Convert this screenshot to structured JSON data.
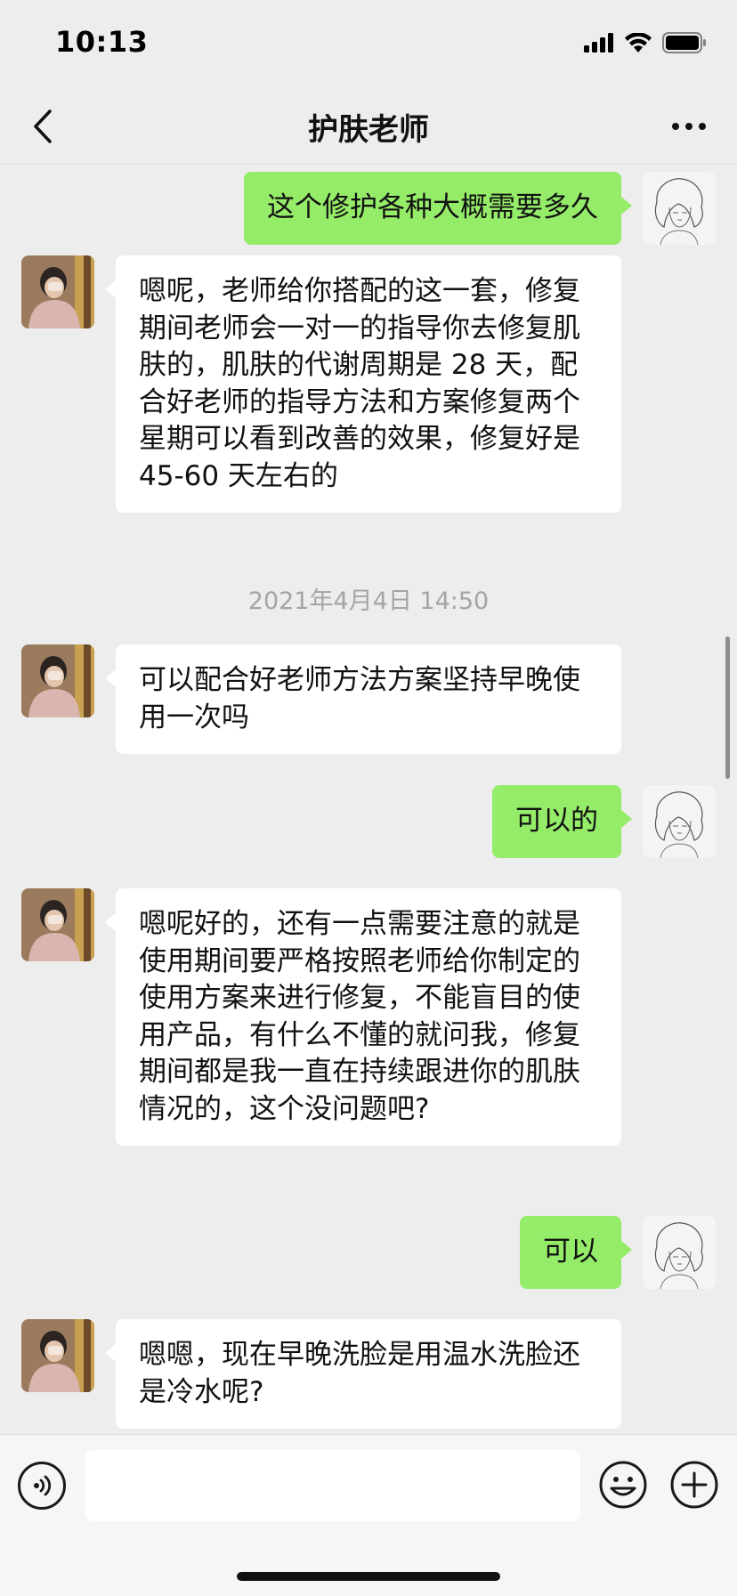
{
  "status_bar": {
    "time": "10:13"
  },
  "header": {
    "title": "护肤老师"
  },
  "messages": [
    {
      "side": "out",
      "text": "这个修护各种大概需要多久"
    },
    {
      "side": "in",
      "text": "嗯呢，老师给你搭配的这一套，修复期间老师会一对一的指导你去修复肌肤的，肌肤的代谢周期是 28 天，配合好老师的指导方法和方案修复两个星期可以看到改善的效果，修复好是 45-60 天左右的"
    },
    {
      "type": "timestamp",
      "text": "2021年4月4日 14:50"
    },
    {
      "side": "in",
      "text": "可以配合好老师方法方案坚持早晚使用一次吗"
    },
    {
      "side": "out",
      "text": "可以的"
    },
    {
      "side": "in",
      "text": "嗯呢好的，还有一点需要注意的就是使用期间要严格按照老师给你制定的使用方案来进行修复，不能盲目的使用产品，有什么不懂的就问我，修复期间都是我一直在持续跟进你的肌肤情况的，这个没问题吧?"
    },
    {
      "side": "out",
      "text": "可以"
    },
    {
      "side": "in",
      "text": "嗯嗯，现在早晚洗脸是用温水洗脸还是冷水呢?"
    }
  ],
  "input": {
    "value": ""
  },
  "colors": {
    "outgoing_bubble": "#95ec69",
    "incoming_bubble": "#ffffff",
    "background": "#ededed"
  },
  "icons": {
    "back": "chevron-left-icon",
    "more": "more-dots-icon",
    "voice": "voice-icon",
    "emoji": "emoji-icon",
    "plus": "plus-icon"
  }
}
